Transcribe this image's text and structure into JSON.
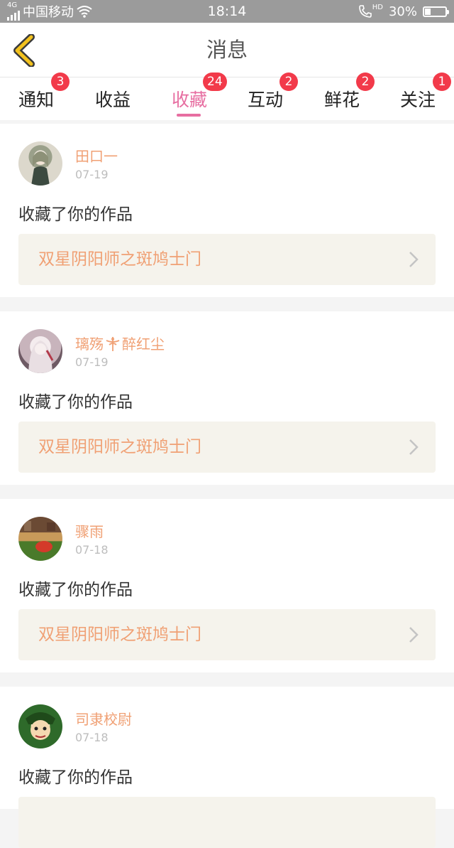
{
  "status_bar": {
    "network": "4G",
    "carrier": "中国移动",
    "time": "18:14",
    "hd": "HD",
    "battery": "30%",
    "battery_level": 0.3
  },
  "nav": {
    "title": "消息"
  },
  "tabs": [
    {
      "label": "通知",
      "badge": "3"
    },
    {
      "label": "收益",
      "badge": ""
    },
    {
      "label": "收藏",
      "badge": "24",
      "active": true
    },
    {
      "label": "互动",
      "badge": "2"
    },
    {
      "label": "鲜花",
      "badge": "2"
    },
    {
      "label": "关注",
      "badge": "1"
    }
  ],
  "items": [
    {
      "user": "田口一",
      "date": "07-19",
      "action": "收藏了你的作品",
      "work": "双星阴阳师之斑鸠士门"
    },
    {
      "user": "璃殇",
      "user_suffix": "醉红尘",
      "date": "07-19",
      "action": "收藏了你的作品",
      "work": "双星阴阳师之斑鸠士门"
    },
    {
      "user": "骤雨",
      "date": "07-18",
      "action": "收藏了你的作品",
      "work": "双星阴阳师之斑鸠士门"
    },
    {
      "user": "司隶校尉",
      "date": "07-18",
      "action": "收藏了你的作品",
      "work": ""
    }
  ],
  "colors": {
    "accent_pink": "#e76ea1",
    "badge_red": "#f23a4a",
    "name_orange": "#f0a074",
    "back_yellow": "#f3c21e"
  },
  "icons": {
    "back": "chevron-left-icon",
    "wifi": "wifi-icon",
    "call": "phone-hd-icon",
    "arrow": "chevron-right-icon"
  }
}
